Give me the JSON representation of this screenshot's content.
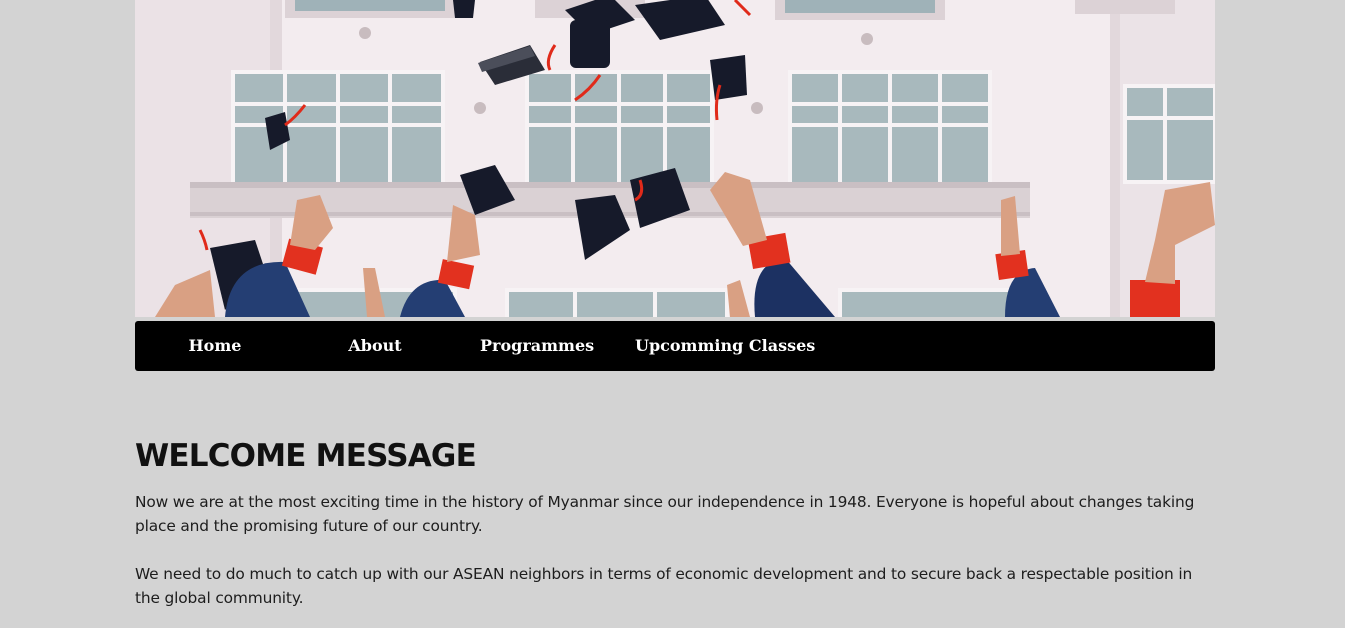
{
  "hero": {
    "icon": "graduation-caps-photo"
  },
  "nav": {
    "items": [
      {
        "label": "Home"
      },
      {
        "label": "About"
      },
      {
        "label": "Programmes"
      },
      {
        "label": "Upcomming Classes"
      }
    ]
  },
  "welcome": {
    "title": "WELCOME MESSAGE",
    "paragraphs": [
      "Now we are at the most exciting time in the history of Myanmar since our independence in 1948. Everyone is hopeful about changes taking place and the promising future of our country.",
      "We need to do much to catch up with our ASEAN neighbors in terms of economic development and to secure back a respectable position in the global community."
    ]
  },
  "colors": {
    "page_background": "#d3d3d3",
    "nav_background": "#000000",
    "nav_text": "#ffffff",
    "gown_blue": "#1f3b72",
    "sleeve_red": "#e0321c"
  }
}
